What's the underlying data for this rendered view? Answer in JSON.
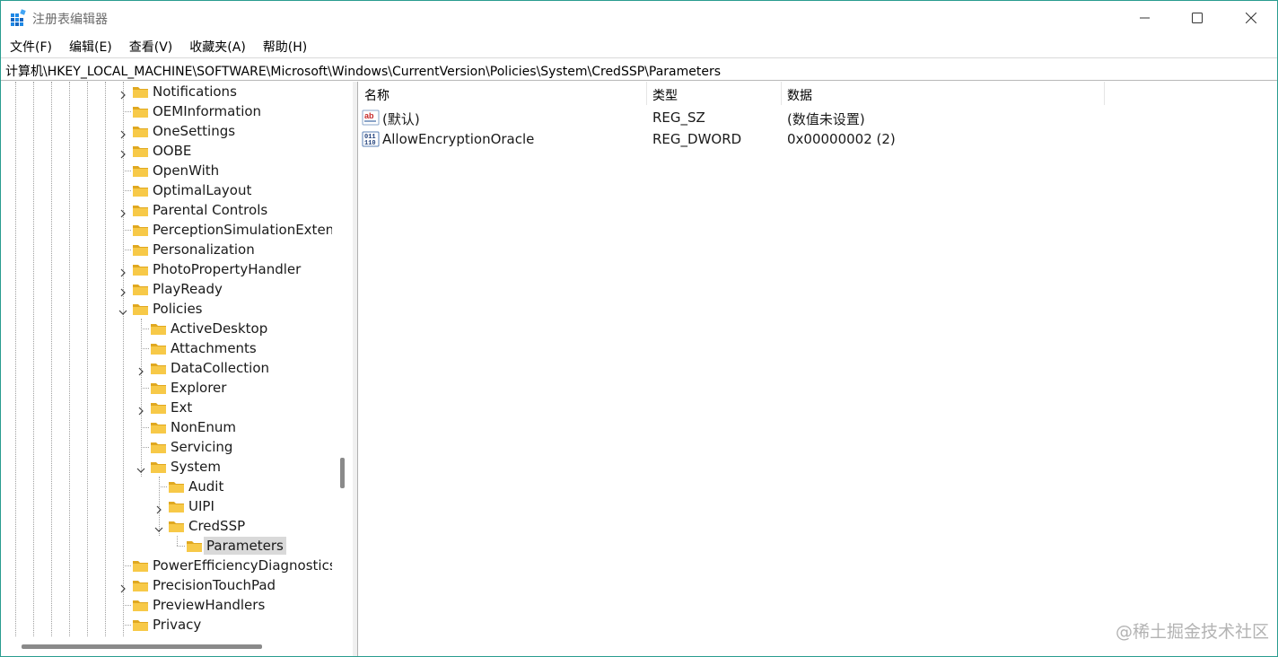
{
  "window": {
    "title": "注册表编辑器"
  },
  "menu": [
    "文件(F)",
    "编辑(E)",
    "查看(V)",
    "收藏夹(A)",
    "帮助(H)"
  ],
  "address": "计算机\\HKEY_LOCAL_MACHINE\\SOFTWARE\\Microsoft\\Windows\\CurrentVersion\\Policies\\System\\CredSSP\\Parameters",
  "tree": [
    {
      "label": "Notifications",
      "level": 0,
      "expander": "collapsed"
    },
    {
      "label": "OEMInformation",
      "level": 0,
      "expander": "none"
    },
    {
      "label": "OneSettings",
      "level": 0,
      "expander": "collapsed"
    },
    {
      "label": "OOBE",
      "level": 0,
      "expander": "collapsed"
    },
    {
      "label": "OpenWith",
      "level": 0,
      "expander": "none"
    },
    {
      "label": "OptimalLayout",
      "level": 0,
      "expander": "none"
    },
    {
      "label": "Parental Controls",
      "level": 0,
      "expander": "collapsed"
    },
    {
      "label": "PerceptionSimulationExten",
      "level": 0,
      "expander": "none"
    },
    {
      "label": "Personalization",
      "level": 0,
      "expander": "none"
    },
    {
      "label": "PhotoPropertyHandler",
      "level": 0,
      "expander": "collapsed"
    },
    {
      "label": "PlayReady",
      "level": 0,
      "expander": "collapsed"
    },
    {
      "label": "Policies",
      "level": 0,
      "expander": "expanded"
    },
    {
      "label": "ActiveDesktop",
      "level": 1,
      "expander": "none"
    },
    {
      "label": "Attachments",
      "level": 1,
      "expander": "none"
    },
    {
      "label": "DataCollection",
      "level": 1,
      "expander": "collapsed"
    },
    {
      "label": "Explorer",
      "level": 1,
      "expander": "none"
    },
    {
      "label": "Ext",
      "level": 1,
      "expander": "collapsed"
    },
    {
      "label": "NonEnum",
      "level": 1,
      "expander": "none"
    },
    {
      "label": "Servicing",
      "level": 1,
      "expander": "none"
    },
    {
      "label": "System",
      "level": 1,
      "expander": "expanded"
    },
    {
      "label": "Audit",
      "level": 2,
      "expander": "none"
    },
    {
      "label": "UIPI",
      "level": 2,
      "expander": "collapsed"
    },
    {
      "label": "CredSSP",
      "level": 2,
      "expander": "expanded"
    },
    {
      "label": "Parameters",
      "level": 3,
      "expander": "none",
      "selected": true
    },
    {
      "label": "PowerEfficiencyDiagnostics",
      "level": 0,
      "expander": "none"
    },
    {
      "label": "PrecisionTouchPad",
      "level": 0,
      "expander": "collapsed"
    },
    {
      "label": "PreviewHandlers",
      "level": 0,
      "expander": "none"
    },
    {
      "label": "Privacy",
      "level": 0,
      "expander": "none"
    }
  ],
  "list": {
    "columns": [
      "名称",
      "类型",
      "数据"
    ],
    "rows": [
      {
        "name": "(默认)",
        "type": "REG_SZ",
        "data": "(数值未设置)",
        "icon": "string-value-icon"
      },
      {
        "name": "AllowEncryptionOracle",
        "type": "REG_DWORD",
        "data": "0x00000002 (2)",
        "icon": "dword-value-icon"
      }
    ]
  },
  "watermark": "@稀土掘金技术社区",
  "colors": {
    "folder": "#f7c948",
    "folder_dark": "#e0a820",
    "selection": "#d9d9d9",
    "window_border": "#2a9d8f"
  }
}
